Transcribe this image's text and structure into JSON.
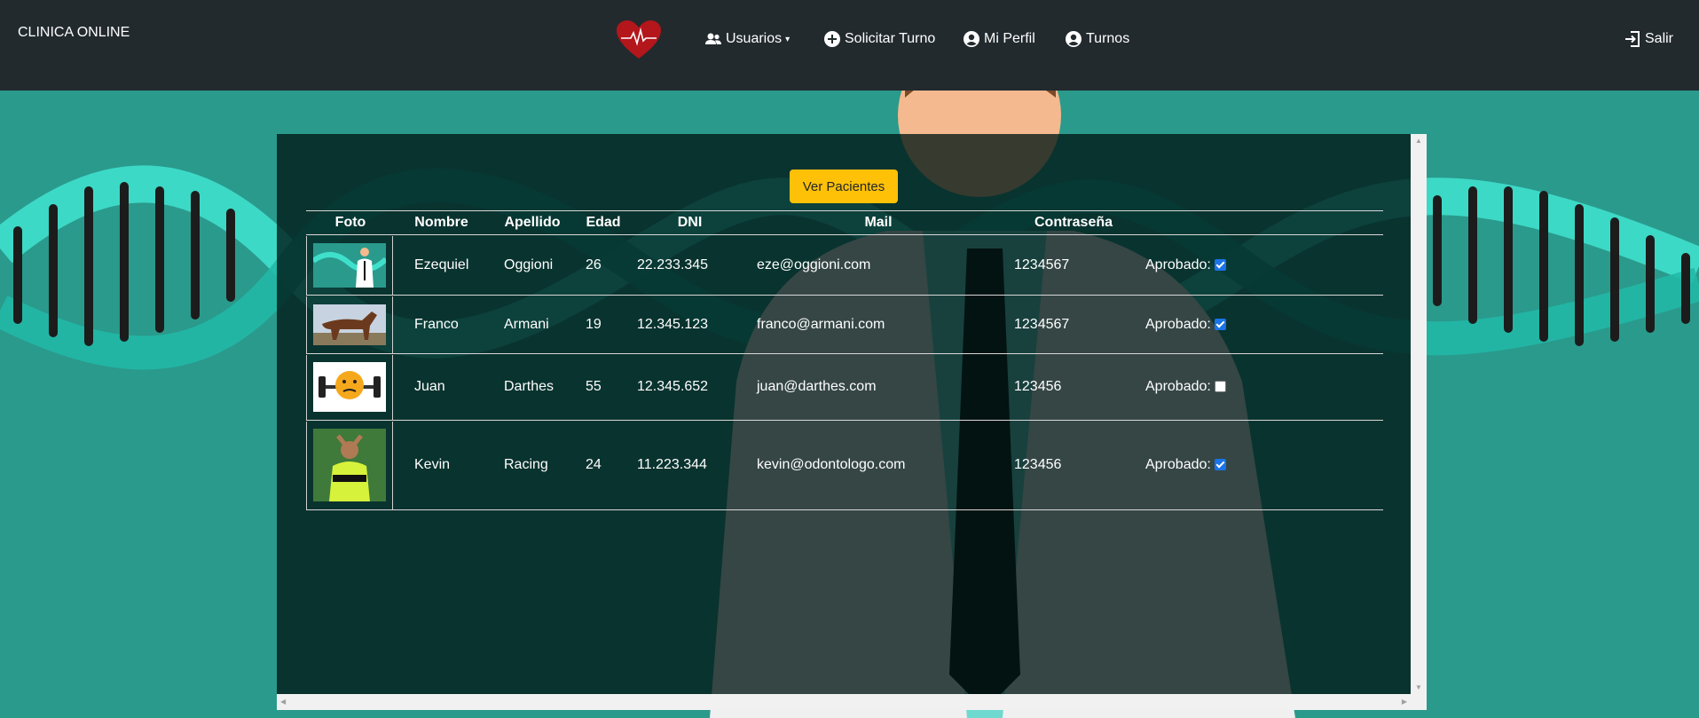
{
  "navbar": {
    "brand": "CLINICA ONLINE",
    "items": [
      {
        "label": "Usuarios",
        "icon": "users-icon",
        "dropdown": true
      },
      {
        "label": "Solicitar Turno",
        "icon": "plus-circle-icon"
      },
      {
        "label": "Mi Perfil",
        "icon": "user-circle-icon"
      },
      {
        "label": "Turnos",
        "icon": "user-circle-icon"
      }
    ],
    "logout": {
      "label": "Salir",
      "icon": "sign-out-icon"
    }
  },
  "panel": {
    "button_label": "Ver Pacientes",
    "table": {
      "headers": [
        "Foto",
        "Nombre",
        "Apellido",
        "Edad",
        "DNI",
        "Mail",
        "Contraseña"
      ],
      "approved_label": "Aprobado:",
      "rows": [
        {
          "photo": "doctor-photo",
          "nombre": "Ezequiel",
          "apellido": "Oggioni",
          "edad": "26",
          "dni": "22.233.345",
          "mail": "eze@oggioni.com",
          "password": "1234567",
          "aprobado": true
        },
        {
          "photo": "horse-photo",
          "nombre": "Franco",
          "apellido": "Armani",
          "edad": "19",
          "dni": "12.345.123",
          "mail": "franco@armani.com",
          "password": "1234567",
          "aprobado": true
        },
        {
          "photo": "emoji-weights-photo",
          "nombre": "Juan",
          "apellido": "Darthes",
          "edad": "55",
          "dni": "12.345.652",
          "mail": "juan@darthes.com",
          "password": "123456",
          "aprobado": false
        },
        {
          "photo": "referee-photo",
          "nombre": "Kevin",
          "apellido": "Racing",
          "edad": "24",
          "dni": "11.223.344",
          "mail": "kevin@odontologo.com",
          "password": "123456",
          "aprobado": true
        }
      ]
    }
  },
  "colors": {
    "navbar_bg": "#222a2e",
    "page_bg": "#2a9a8c",
    "button_bg": "#ffc107",
    "checkbox_checked": "#1a73e8"
  }
}
